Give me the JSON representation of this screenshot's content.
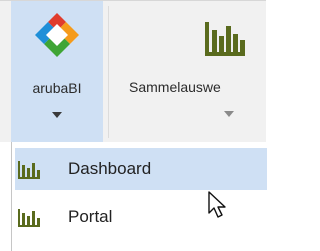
{
  "ribbon": {
    "arubabi_button": {
      "label": "arubaBI",
      "icon": "arubabi-logo"
    },
    "sammelauswertung_button": {
      "label": "Sammelauswe",
      "icon": "bar-chart-icon"
    }
  },
  "dropdown": {
    "items": [
      {
        "label": "Dashboard",
        "icon": "bar-chart-icon",
        "highlighted": true
      },
      {
        "label": "Portal",
        "icon": "bar-chart-icon",
        "highlighted": false
      }
    ]
  },
  "colors": {
    "ribbon_background": "#f1f1f1",
    "selected_background": "#cfe0f4",
    "logo_red": "#e03c2d",
    "logo_orange": "#f59b1b",
    "logo_green": "#3fa535",
    "logo_blue": "#1f8fd8",
    "chart_icon": "#5a6b1e"
  }
}
